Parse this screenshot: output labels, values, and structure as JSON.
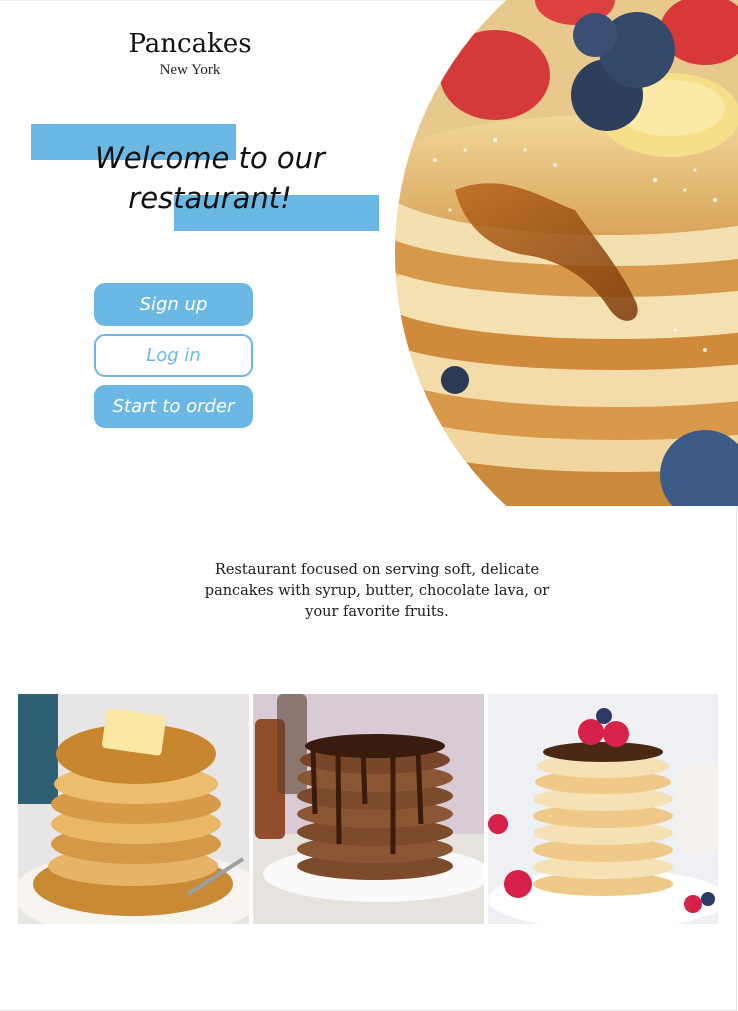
{
  "brand": {
    "name": "Pancakes",
    "city": "New York"
  },
  "hero": {
    "welcome_line1": "Welcome to our",
    "welcome_line2": "restaurant!"
  },
  "actions": {
    "signup_label": "Sign up",
    "login_label": "Log in",
    "order_label": "Start to order"
  },
  "about": {
    "line1": "Restaurant focused on serving soft, delicate",
    "line2": "pancakes with syrup, butter, chocolate lava, or",
    "line3": "your favorite fruits."
  },
  "colors": {
    "accent": "#6cb8e4",
    "background": "#ffffff",
    "text": "#1a1a1a"
  }
}
